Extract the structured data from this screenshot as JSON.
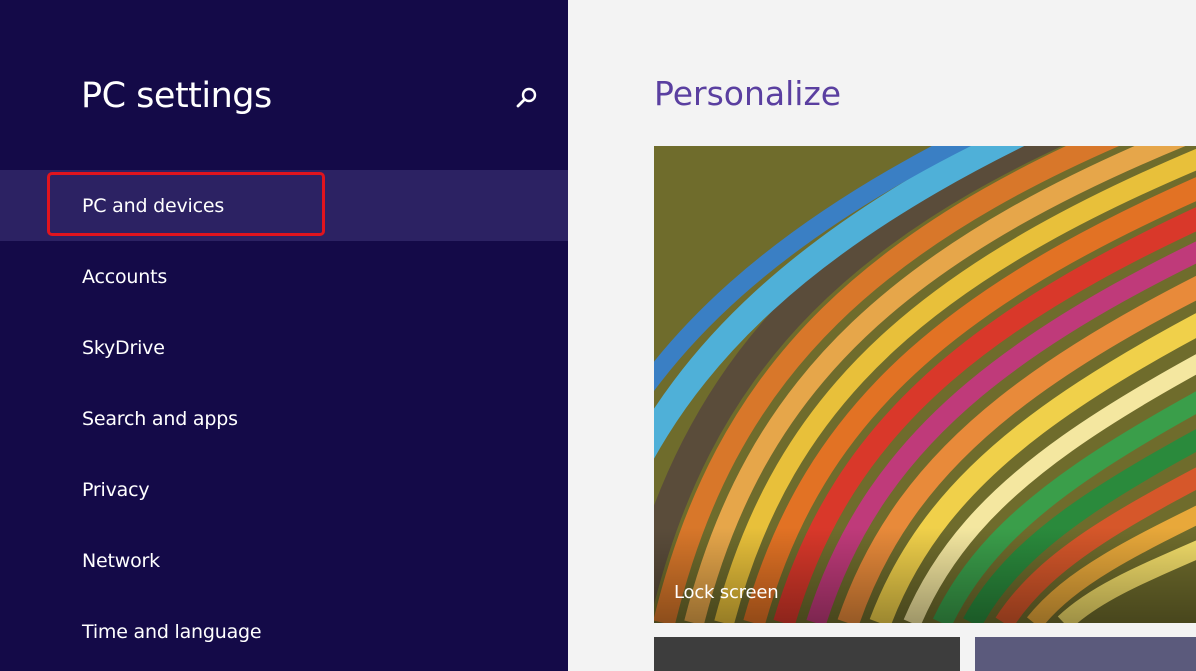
{
  "app_title": "PC settings",
  "search": {
    "icon": "search-icon"
  },
  "nav": {
    "items": [
      {
        "label": "PC and devices",
        "selected": true
      },
      {
        "label": "Accounts"
      },
      {
        "label": "SkyDrive"
      },
      {
        "label": "Search and apps"
      },
      {
        "label": "Privacy"
      },
      {
        "label": "Network"
      },
      {
        "label": "Time and language"
      }
    ]
  },
  "main": {
    "title": "Personalize",
    "tiles": [
      {
        "label": "Lock screen"
      }
    ]
  },
  "colors": {
    "sidebar_bg": "#140a48",
    "selected_bg": "#2c2263",
    "title_accent": "#5a3fa0",
    "highlight_border": "#e0141e"
  }
}
